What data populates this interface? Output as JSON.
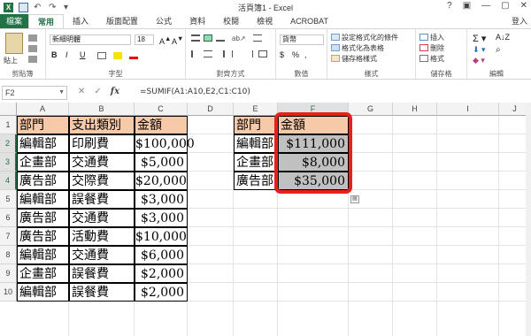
{
  "window": {
    "title": "活頁簿1 - Excel",
    "icons": [
      "excel-icon",
      "save-icon",
      "undo-icon",
      "redo-icon",
      "customize-icon"
    ],
    "controls": [
      "?",
      "▢",
      "—",
      "▢",
      "✕"
    ]
  },
  "menu": {
    "file": "檔案",
    "tabs": [
      "常用",
      "插入",
      "版面配置",
      "公式",
      "資料",
      "校閱",
      "檢視",
      "ACROBAT"
    ],
    "active": "常用",
    "login": "登入"
  },
  "ribbon": {
    "clipboard": {
      "paste": "貼上",
      "label": "剪貼簿"
    },
    "font": {
      "name": "新細明體",
      "size": "18",
      "label": "字型",
      "bold": "B",
      "italic": "I",
      "underline": "U"
    },
    "alignment": {
      "label": "對齊方式"
    },
    "number": {
      "format": "貨幣",
      "pct": "%",
      "comma": ",",
      "dollar": "$",
      "label": "數值"
    },
    "styles": {
      "cond": "設定格式化的條件",
      "table": "格式化為表格",
      "cell": "儲存格樣式",
      "label": "樣式"
    },
    "cells": {
      "insert": "插入",
      "delete": "刪除",
      "format": "格式",
      "label": "儲存格"
    },
    "editing": {
      "label": "編輯"
    }
  },
  "formula_bar": {
    "name_box": "F2",
    "fx": "fx",
    "formula": "=SUMIF(A1:A10,E2,C1:C10)"
  },
  "sheet": {
    "columns": [
      "A",
      "B",
      "C",
      "D",
      "E",
      "F",
      "G",
      "H",
      "I",
      "J"
    ],
    "rows": [
      "1",
      "2",
      "3",
      "4",
      "5",
      "6",
      "7",
      "8",
      "9",
      "10"
    ],
    "table": {
      "header": [
        "部門",
        "支出類別",
        "金額"
      ],
      "rows": [
        [
          "編輯部",
          "印刷費",
          "$100,000"
        ],
        [
          "企畫部",
          "交通費",
          "$5,000"
        ],
        [
          "廣告部",
          "交際費",
          "$20,000"
        ],
        [
          "編輯部",
          "誤餐費",
          "$3,000"
        ],
        [
          "廣告部",
          "交通費",
          "$3,000"
        ],
        [
          "廣告部",
          "活動費",
          "$10,000"
        ],
        [
          "編輯部",
          "交通費",
          "$6,000"
        ],
        [
          "企畫部",
          "誤餐費",
          "$2,000"
        ],
        [
          "編輯部",
          "誤餐費",
          "$2,000"
        ]
      ]
    },
    "summary": {
      "header": [
        "部門",
        "金額"
      ],
      "rows": [
        [
          "編輯部",
          "$111,000"
        ],
        [
          "企畫部",
          "$8,000"
        ],
        [
          "廣告部",
          "$35,000"
        ]
      ]
    }
  }
}
